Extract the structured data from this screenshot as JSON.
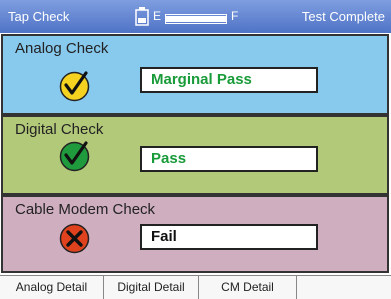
{
  "topbar": {
    "title": "Tap Check",
    "battery_empty_label": "E",
    "battery_full_label": "F",
    "battery_level": 1.0,
    "status": "Test Complete"
  },
  "checks": [
    {
      "heading": "Analog Check",
      "result": "Marginal Pass",
      "result_color": "#1a9b3a",
      "icon": "check-yellow-icon",
      "icon_color": "#f4d21f"
    },
    {
      "heading": "Digital Check",
      "result": "Pass",
      "result_color": "#1a9b3a",
      "icon": "check-green-icon",
      "icon_color": "#1f9a3c"
    },
    {
      "heading": "Cable Modem Check",
      "result": "Fail",
      "result_color": "#111111",
      "icon": "fail-red-icon",
      "icon_color": "#e0421e"
    }
  ],
  "tabs": [
    {
      "label": "Analog Detail"
    },
    {
      "label": "Digital Detail"
    },
    {
      "label": "CM Detail"
    },
    {
      "label": ""
    }
  ],
  "colors": {
    "topbar": "#5b7dcc",
    "analog_bg": "#88c9ee",
    "digital_bg": "#b3c97a",
    "cable_bg": "#cfaec0"
  }
}
